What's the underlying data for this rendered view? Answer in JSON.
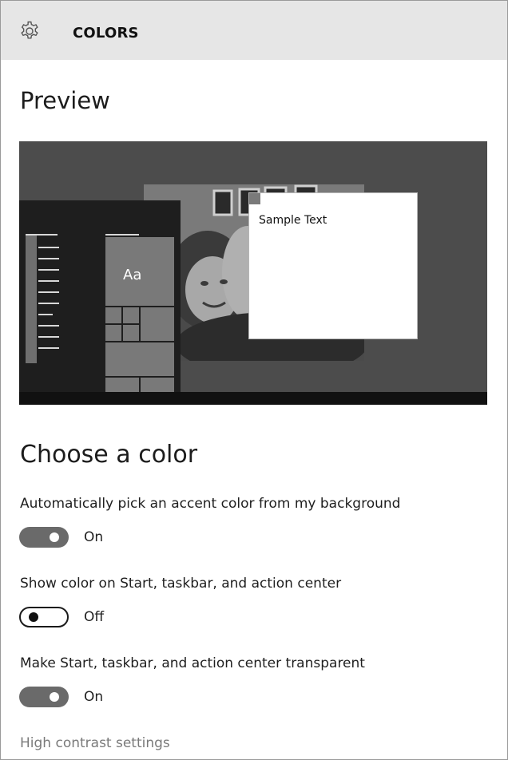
{
  "header": {
    "title": "COLORS",
    "icon": "gear-icon"
  },
  "preview": {
    "title": "Preview",
    "tile_label": "Aa",
    "sample_text": "Sample Text"
  },
  "choose": {
    "title": "Choose a color",
    "settings": [
      {
        "label": "Automatically pick an accent color from my background",
        "state": "On",
        "enabled": true
      },
      {
        "label": "Show color on Start, taskbar, and action center",
        "state": "Off",
        "enabled": false
      },
      {
        "label": "Make Start, taskbar, and action center transparent",
        "state": "On",
        "enabled": true
      }
    ]
  },
  "links": {
    "high_contrast": "High contrast settings"
  },
  "colors": {
    "header_bg": "#e6e6e6",
    "preview_bg": "#4c4c4c",
    "toggle_on": "#6a6a6a",
    "link": "#7a7a7a"
  }
}
